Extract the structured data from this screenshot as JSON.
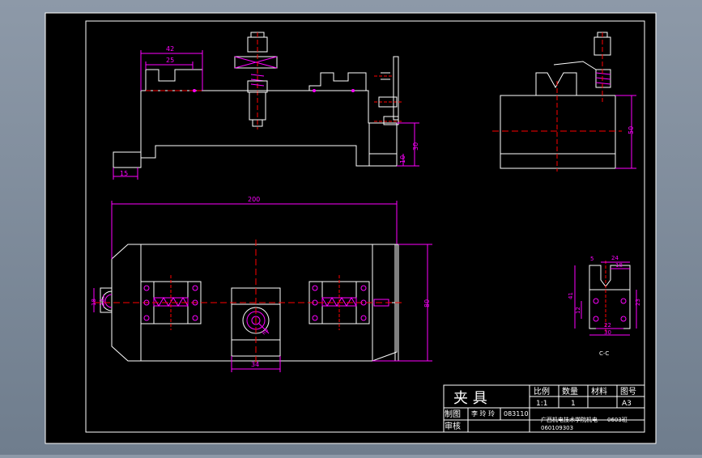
{
  "colors": {
    "background": "#000000",
    "outline": "#ffffff",
    "dimension": "#ff00ff",
    "centerline": "#ff0000",
    "hidden": "#00ff00",
    "viewport": "#7f8c9b"
  },
  "dimensions": {
    "top_42": "42",
    "top_25": "25",
    "side_15": "15",
    "side_10": "10",
    "side_30": "30",
    "right_50": "50",
    "plan_200": "200",
    "plan_80": "80",
    "plan_34": "34",
    "plan_18": "18",
    "plan_12": "12",
    "plan_r": "R8",
    "detail_5": "5",
    "detail_24": "24",
    "detail_18": "18",
    "detail_41": "41",
    "detail_12": "12",
    "detail_23": "23",
    "detail_22": "22",
    "detail_30": "30"
  },
  "section_label": "C-C",
  "title_block": {
    "name": "夹 具",
    "scale_header": "比例",
    "qty_header": "数量",
    "material_header": "材料",
    "drawing_no_header": "图号",
    "scale_value": "1:1",
    "qty_value": "1",
    "material_value": "",
    "drawing_no_value": "A3",
    "drawn_label": "制图",
    "checked_label": "审核",
    "drawn_name": "李 玲 玲",
    "drawn_date": "083110",
    "school": "广西机电技术学院机电",
    "class": "0603班",
    "student_no": "060109303"
  }
}
